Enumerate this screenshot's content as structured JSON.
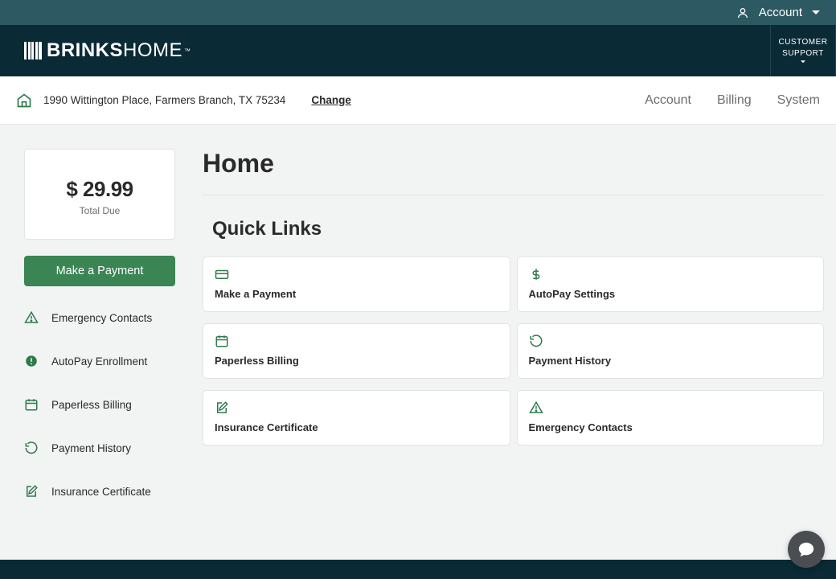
{
  "topbar": {
    "account_label": "Account"
  },
  "header": {
    "logo_bold": "BRINKS",
    "logo_light": "HOME",
    "support_line1": "CUSTOMER",
    "support_line2": "SUPPORT"
  },
  "subnav": {
    "address": "1990 Wittington Place, Farmers Branch, TX 75234",
    "change_label": "Change",
    "links": {
      "account": "Account",
      "billing": "Billing",
      "system": "System"
    }
  },
  "sidebar": {
    "amount": "$ 29.99",
    "due_label": "Total Due",
    "pay_button": "Make a Payment",
    "links": {
      "emergency": "Emergency Contacts",
      "autopay": "AutoPay Enrollment",
      "paperless": "Paperless Billing",
      "history": "Payment History",
      "insurance": "Insurance Certificate"
    }
  },
  "main": {
    "title": "Home",
    "section": "Quick Links",
    "cards": {
      "payment": "Make a Payment",
      "autopay": "AutoPay Settings",
      "paperless": "Paperless Billing",
      "history": "Payment History",
      "insurance": "Insurance Certificate",
      "emergency": "Emergency Contacts"
    }
  }
}
